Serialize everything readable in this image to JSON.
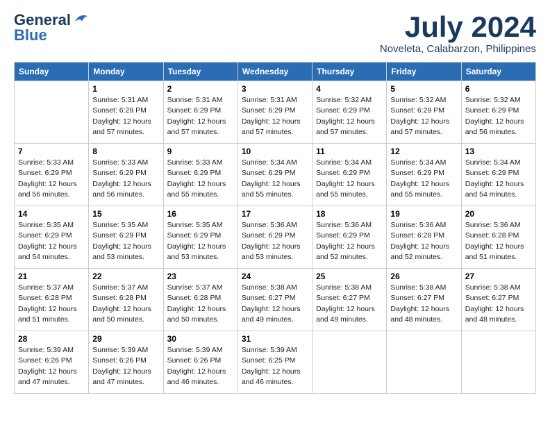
{
  "logo": {
    "line1": "General",
    "line2": "Blue"
  },
  "title": "July 2024",
  "location": "Noveleta, Calabarzon, Philippines",
  "days_of_week": [
    "Sunday",
    "Monday",
    "Tuesday",
    "Wednesday",
    "Thursday",
    "Friday",
    "Saturday"
  ],
  "weeks": [
    [
      {
        "day": "",
        "sunrise": "",
        "sunset": "",
        "daylight": ""
      },
      {
        "day": "1",
        "sunrise": "5:31 AM",
        "sunset": "6:29 PM",
        "daylight": "12 hours and 57 minutes."
      },
      {
        "day": "2",
        "sunrise": "5:31 AM",
        "sunset": "6:29 PM",
        "daylight": "12 hours and 57 minutes."
      },
      {
        "day": "3",
        "sunrise": "5:31 AM",
        "sunset": "6:29 PM",
        "daylight": "12 hours and 57 minutes."
      },
      {
        "day": "4",
        "sunrise": "5:32 AM",
        "sunset": "6:29 PM",
        "daylight": "12 hours and 57 minutes."
      },
      {
        "day": "5",
        "sunrise": "5:32 AM",
        "sunset": "6:29 PM",
        "daylight": "12 hours and 57 minutes."
      },
      {
        "day": "6",
        "sunrise": "5:32 AM",
        "sunset": "6:29 PM",
        "daylight": "12 hours and 56 minutes."
      }
    ],
    [
      {
        "day": "7",
        "sunrise": "5:33 AM",
        "sunset": "6:29 PM",
        "daylight": "12 hours and 56 minutes."
      },
      {
        "day": "8",
        "sunrise": "5:33 AM",
        "sunset": "6:29 PM",
        "daylight": "12 hours and 56 minutes."
      },
      {
        "day": "9",
        "sunrise": "5:33 AM",
        "sunset": "6:29 PM",
        "daylight": "12 hours and 55 minutes."
      },
      {
        "day": "10",
        "sunrise": "5:34 AM",
        "sunset": "6:29 PM",
        "daylight": "12 hours and 55 minutes."
      },
      {
        "day": "11",
        "sunrise": "5:34 AM",
        "sunset": "6:29 PM",
        "daylight": "12 hours and 55 minutes."
      },
      {
        "day": "12",
        "sunrise": "5:34 AM",
        "sunset": "6:29 PM",
        "daylight": "12 hours and 55 minutes."
      },
      {
        "day": "13",
        "sunrise": "5:34 AM",
        "sunset": "6:29 PM",
        "daylight": "12 hours and 54 minutes."
      }
    ],
    [
      {
        "day": "14",
        "sunrise": "5:35 AM",
        "sunset": "6:29 PM",
        "daylight": "12 hours and 54 minutes."
      },
      {
        "day": "15",
        "sunrise": "5:35 AM",
        "sunset": "6:29 PM",
        "daylight": "12 hours and 53 minutes."
      },
      {
        "day": "16",
        "sunrise": "5:35 AM",
        "sunset": "6:29 PM",
        "daylight": "12 hours and 53 minutes."
      },
      {
        "day": "17",
        "sunrise": "5:36 AM",
        "sunset": "6:29 PM",
        "daylight": "12 hours and 53 minutes."
      },
      {
        "day": "18",
        "sunrise": "5:36 AM",
        "sunset": "6:29 PM",
        "daylight": "12 hours and 52 minutes."
      },
      {
        "day": "19",
        "sunrise": "5:36 AM",
        "sunset": "6:28 PM",
        "daylight": "12 hours and 52 minutes."
      },
      {
        "day": "20",
        "sunrise": "5:36 AM",
        "sunset": "6:28 PM",
        "daylight": "12 hours and 51 minutes."
      }
    ],
    [
      {
        "day": "21",
        "sunrise": "5:37 AM",
        "sunset": "6:28 PM",
        "daylight": "12 hours and 51 minutes."
      },
      {
        "day": "22",
        "sunrise": "5:37 AM",
        "sunset": "6:28 PM",
        "daylight": "12 hours and 50 minutes."
      },
      {
        "day": "23",
        "sunrise": "5:37 AM",
        "sunset": "6:28 PM",
        "daylight": "12 hours and 50 minutes."
      },
      {
        "day": "24",
        "sunrise": "5:38 AM",
        "sunset": "6:27 PM",
        "daylight": "12 hours and 49 minutes."
      },
      {
        "day": "25",
        "sunrise": "5:38 AM",
        "sunset": "6:27 PM",
        "daylight": "12 hours and 49 minutes."
      },
      {
        "day": "26",
        "sunrise": "5:38 AM",
        "sunset": "6:27 PM",
        "daylight": "12 hours and 48 minutes."
      },
      {
        "day": "27",
        "sunrise": "5:38 AM",
        "sunset": "6:27 PM",
        "daylight": "12 hours and 48 minutes."
      }
    ],
    [
      {
        "day": "28",
        "sunrise": "5:39 AM",
        "sunset": "6:26 PM",
        "daylight": "12 hours and 47 minutes."
      },
      {
        "day": "29",
        "sunrise": "5:39 AM",
        "sunset": "6:26 PM",
        "daylight": "12 hours and 47 minutes."
      },
      {
        "day": "30",
        "sunrise": "5:39 AM",
        "sunset": "6:26 PM",
        "daylight": "12 hours and 46 minutes."
      },
      {
        "day": "31",
        "sunrise": "5:39 AM",
        "sunset": "6:25 PM",
        "daylight": "12 hours and 46 minutes."
      },
      {
        "day": "",
        "sunrise": "",
        "sunset": "",
        "daylight": ""
      },
      {
        "day": "",
        "sunrise": "",
        "sunset": "",
        "daylight": ""
      },
      {
        "day": "",
        "sunrise": "",
        "sunset": "",
        "daylight": ""
      }
    ]
  ],
  "labels": {
    "sunrise_prefix": "Sunrise: ",
    "sunset_prefix": "Sunset: ",
    "daylight_label": "Daylight: "
  }
}
